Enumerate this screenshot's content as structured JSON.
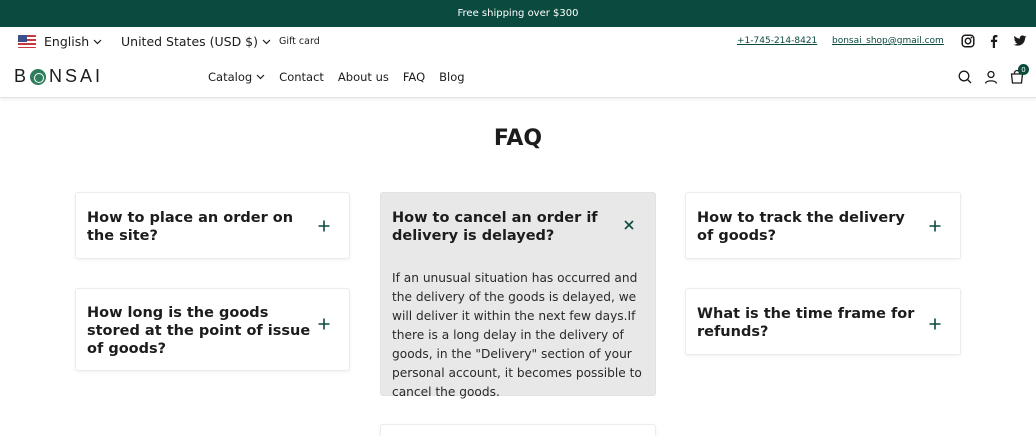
{
  "announcement": "Free shipping over $300",
  "utility": {
    "language": "English",
    "currency": "United States (USD $)",
    "gift_card": "Gift card",
    "phone": "+1-745-214-8421",
    "email": "bonsai_shop@gmail.com",
    "social_icons": [
      "instagram-icon",
      "facebook-icon",
      "twitter-icon"
    ]
  },
  "brand": {
    "logo_text_pre": "B",
    "logo_text_post": "NSAI"
  },
  "nav": {
    "items": [
      "Catalog",
      "Contact",
      "About us",
      "FAQ",
      "Blog"
    ],
    "cart_count": "0"
  },
  "page": {
    "title": "FAQ"
  },
  "faq": [
    {
      "question": "How to place an order on the site?",
      "open": false
    },
    {
      "question": "How to cancel an order if delivery is delayed?",
      "open": true,
      "answer": "If an unusual situation has occurred and the delivery of the goods is delayed, we will deliver it within the next few days.If there is a long delay in the delivery of goods, in the \"Delivery\" section of your personal account, it becomes possible to cancel the goods."
    },
    {
      "question": "How to track the delivery of goods?",
      "open": false
    },
    {
      "question": "How long is the goods stored at the point of issue of goods?",
      "open": false
    },
    {
      "question": "What is the time frame for refunds?",
      "open": false
    }
  ],
  "colors": {
    "brand": "#0b4a3f",
    "open_card": "#e8e8e8"
  }
}
